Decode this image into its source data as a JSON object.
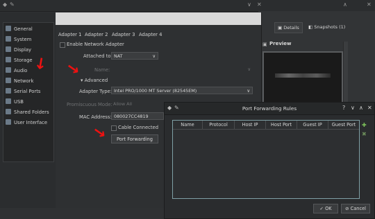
{
  "settings": {
    "sidebar": [
      {
        "label": "General",
        "icon": "general-icon"
      },
      {
        "label": "System",
        "icon": "system-icon"
      },
      {
        "label": "Display",
        "icon": "display-icon"
      },
      {
        "label": "Storage",
        "icon": "storage-icon"
      },
      {
        "label": "Audio",
        "icon": "audio-icon"
      },
      {
        "label": "Network",
        "icon": "network-icon"
      },
      {
        "label": "Serial Ports",
        "icon": "serial-ports-icon"
      },
      {
        "label": "USB",
        "icon": "usb-icon"
      },
      {
        "label": "Shared Folders",
        "icon": "shared-folders-icon"
      },
      {
        "label": "User Interface",
        "icon": "user-interface-icon"
      }
    ],
    "tabs": [
      "Adapter 1",
      "Adapter 2",
      "Adapter 3",
      "Adapter 4"
    ],
    "enable_label": "Enable Network Adapter",
    "attached_label": "Attached to:",
    "attached_value": "NAT",
    "name_label": "Name:",
    "advanced_label": "Advanced",
    "adapter_type_label": "Adapter Type:",
    "adapter_type_value": "Intel PRO/1000 MT Server (82545EM)",
    "promiscuous_label": "Promiscuous Mode:",
    "promiscuous_value": "Allow All",
    "mac_label": "MAC Address:",
    "mac_value": "080027CC4819",
    "cable_label": "Cable Connected",
    "port_forwarding_label": "Port Forwarding"
  },
  "manager": {
    "details_label": "Details",
    "snapshots_label": "Snapshots (1)",
    "preview_label": "Preview"
  },
  "pf_dialog": {
    "title": "Port Forwarding Rules",
    "title_buttons": [
      "?",
      "∨",
      "∧",
      "✕"
    ],
    "columns": [
      "Name",
      "Protocol",
      "Host IP",
      "Host Port",
      "Guest IP",
      "Guest Port"
    ],
    "ok_label": "OK",
    "cancel_label": "Cancel"
  }
}
